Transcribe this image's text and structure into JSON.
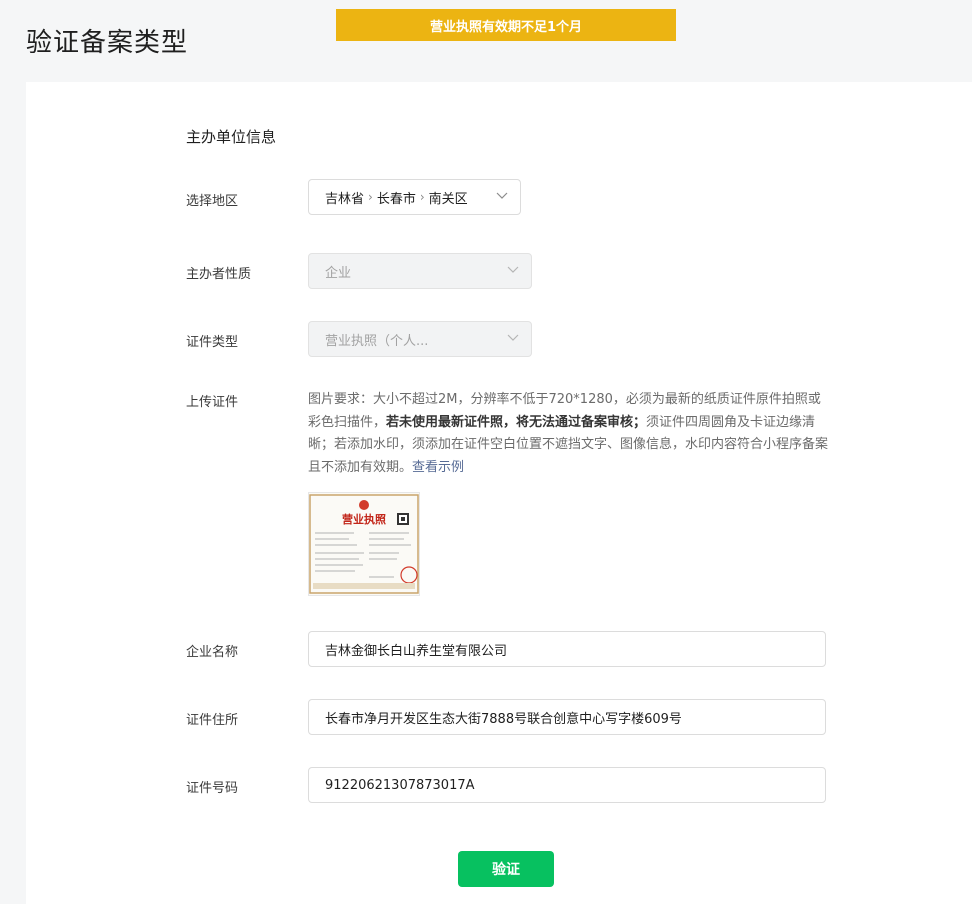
{
  "page": {
    "title": "验证备案类型",
    "banner": "营业执照有效期不足1个月"
  },
  "form": {
    "section_title": "主办单位信息",
    "region": {
      "label": "选择地区",
      "province": "吉林省",
      "city": "长春市",
      "district": "南关区"
    },
    "organizer_type": {
      "label": "主办者性质",
      "value": "企业"
    },
    "cert_type": {
      "label": "证件类型",
      "value": "营业执照（个人..."
    },
    "upload": {
      "label": "上传证件",
      "requirement_text_1": "图片要求：大小不超过2M，分辨率不低于720*1280，必须为最新的纸质证件原件拍照或彩色扫描件，",
      "requirement_bold": "若未使用最新证件照，将无法通过备案审核；",
      "requirement_text_2": "须证件四周圆角及卡证边缘清晰；若添加水印，须添加在证件空白位置不遮挡文字、图像信息，水印内容符合小程序备案且不添加有效期。",
      "example_link": "查看示例",
      "thumb_title": "营业执照"
    },
    "company_name": {
      "label": "企业名称",
      "value": "吉林金御长白山养生堂有限公司"
    },
    "address": {
      "label": "证件住所",
      "value": "长春市净月开发区生态大街7888号联合创意中心写字楼609号"
    },
    "cert_number": {
      "label": "证件号码",
      "value": "91220621307873017A"
    },
    "submit_label": "验证"
  },
  "colors": {
    "banner": "#ecb412",
    "primary": "#07c160",
    "link": "#576b95"
  }
}
